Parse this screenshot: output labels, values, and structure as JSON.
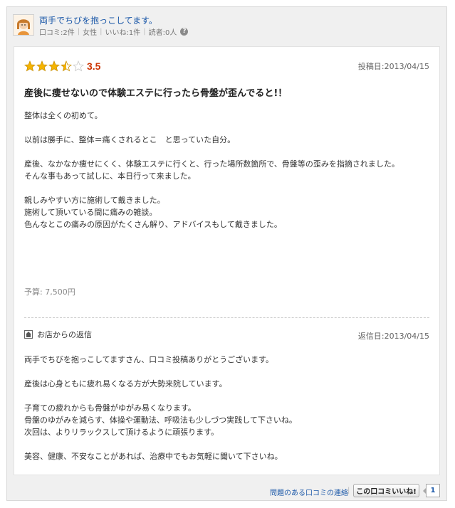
{
  "reviewer": {
    "name": "両手でちびを抱っこしてます。",
    "meta": [
      "口コミ:2件",
      "女性",
      "いいね:1件",
      "読者:0人"
    ]
  },
  "review": {
    "rating_value": 3.5,
    "rating_text": "3.5",
    "posted_date": "投稿日:2013/04/15",
    "title": "産後に痩せないので体験エステに行ったら骨盤が歪んでると!！",
    "paragraphs": [
      [
        "整体は全くの初めて。"
      ],
      [
        "以前は勝手に、整体＝痛くされるとこ　と思っていた自分。"
      ],
      [
        "産後、なかなか痩せにくく、体験エステに行くと、行った場所数箇所で、骨盤等の歪みを指摘されました。",
        "そんな事もあって試しに、本日行って来ました。"
      ],
      [
        "親しみやすい方に施術して戴きました。",
        "施術して頂いている間に痛みの雑談。",
        "色んなとこの痛みの原因がたくさん解り、アドバイスもして戴きました。"
      ]
    ],
    "budget": "予算: 7,500円"
  },
  "reply": {
    "heading": "お店からの返信",
    "date": "返信日:2013/04/15",
    "paragraphs": [
      [
        "両手でちびを抱っこしてますさん、口コミ投稿ありがとうございます。"
      ],
      [
        "産後は心身ともに疲れ易くなる方が大勢来院しています。"
      ],
      [
        "子育ての疲れからも骨盤がゆがみ易くなります。",
        "骨盤のゆがみを減らす、体操や運動法、呼吸法も少しづつ実践して下さいね。",
        "次回は、よりリラックスして頂けるように頑張ります。"
      ],
      [
        "美容、健康、不安なことがあれば、治療中でもお気軽に聞いて下さいね。"
      ]
    ]
  },
  "footer": {
    "report_link": "問題のある口コミの連絡",
    "like_button": "この口コミいいね!",
    "like_count": "1"
  },
  "colors": {
    "link": "#1a57a8",
    "star": "#f5b400",
    "rating": "#cc3300"
  },
  "icons": [
    "help-icon",
    "star-icon",
    "house-icon",
    "avatar-icon"
  ]
}
